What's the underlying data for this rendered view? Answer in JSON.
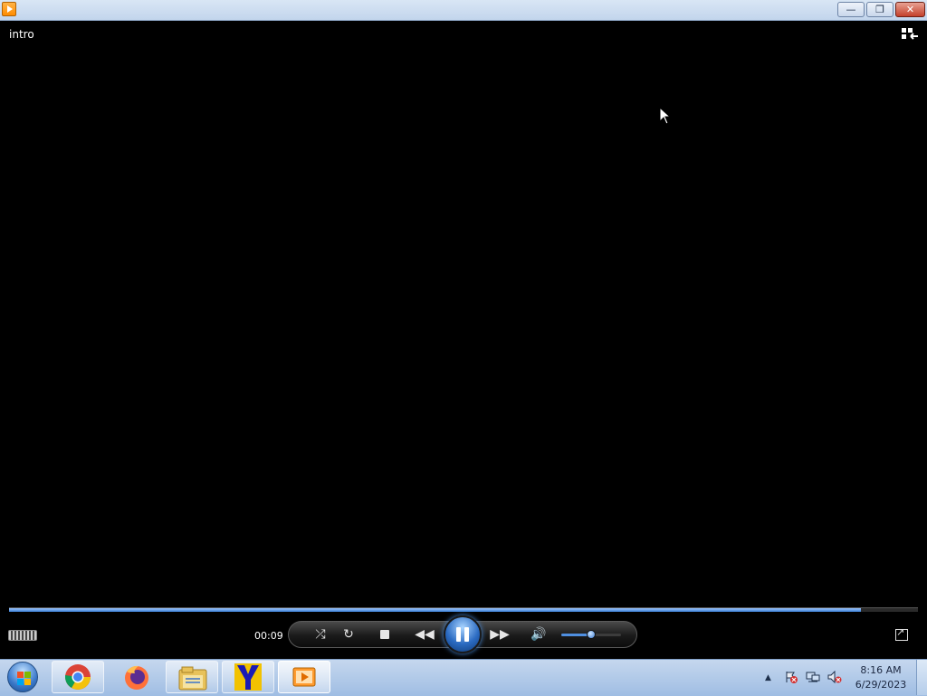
{
  "window": {
    "icon": "media-player-icon",
    "buttons": {
      "minimize": "—",
      "maximize": "❐",
      "close": "✕"
    }
  },
  "player": {
    "media_title": "intro",
    "elapsed_time": "00:09",
    "progress": 0.937,
    "volume": 0.5,
    "icons": {
      "switch_to_library": "switch-to-library-icon",
      "shuffle": "⤮",
      "repeat": "↻",
      "previous": "◀◀",
      "next": "▶▶",
      "mute": "🔊"
    }
  },
  "taskbar": {
    "apps": [
      {
        "name": "chrome",
        "icon": "chrome-icon"
      },
      {
        "name": "firefox",
        "icon": "firefox-icon"
      },
      {
        "name": "file-explorer",
        "icon": "folder-icon"
      },
      {
        "name": "y-app",
        "icon": "y-logo-icon"
      },
      {
        "name": "media-player",
        "icon": "media-player-icon"
      }
    ],
    "tray": {
      "time": "8:16 AM",
      "date": "6/29/2023"
    }
  },
  "colors": {
    "accent": "#3b7fd4",
    "titlebar": "#c2d5ec",
    "taskbar": "#9fbde3"
  }
}
